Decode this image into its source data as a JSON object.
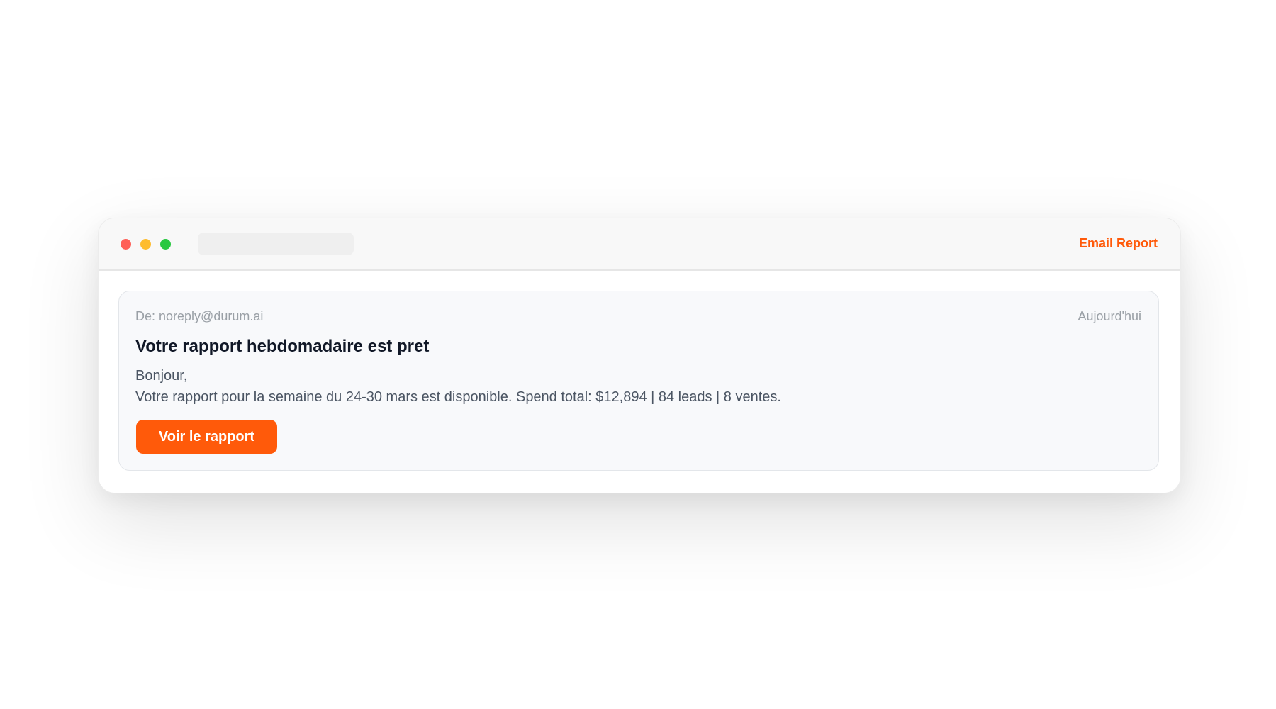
{
  "window": {
    "title": "Email Report",
    "accent_color": "#ff5a0a",
    "controls": [
      {
        "name": "close",
        "color": "#ff5f57"
      },
      {
        "name": "minimize",
        "color": "#febc2e"
      },
      {
        "name": "maximize",
        "color": "#28c840"
      }
    ]
  },
  "email": {
    "from": "De: noreply@durum.ai",
    "date": "Aujourd'hui",
    "subject": "Votre rapport hebdomadaire est pret",
    "greeting": "Bonjour,",
    "body": "Votre rapport pour la semaine du 24-30 mars est disponible. Spend total: $12,894 | 84 leads | 8 ventes.",
    "cta_label": "Voir le rapport"
  }
}
